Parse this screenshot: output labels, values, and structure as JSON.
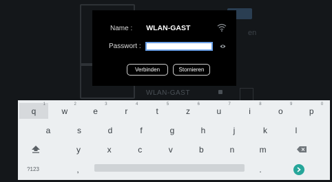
{
  "background": {
    "ssid_text": "WLAN-GAST",
    "partial_text": "en"
  },
  "dialog": {
    "name_label": "Name :",
    "name_value": "WLAN-GAST",
    "password_label": "Passwort :",
    "password_value": "",
    "connect_label": "Verbinden",
    "cancel_label": "Stornieren"
  },
  "keyboard": {
    "row1": [
      {
        "key": "q",
        "hint": "1"
      },
      {
        "key": "w",
        "hint": "2"
      },
      {
        "key": "e",
        "hint": "3"
      },
      {
        "key": "r",
        "hint": "4"
      },
      {
        "key": "t",
        "hint": "5"
      },
      {
        "key": "z",
        "hint": "6"
      },
      {
        "key": "u",
        "hint": "7"
      },
      {
        "key": "i",
        "hint": "8"
      },
      {
        "key": "o",
        "hint": "9"
      },
      {
        "key": "p",
        "hint": "0"
      }
    ],
    "row2": [
      "a",
      "s",
      "d",
      "f",
      "g",
      "h",
      "j",
      "k",
      "l"
    ],
    "row3": [
      "y",
      "x",
      "c",
      "v",
      "b",
      "n",
      "m"
    ],
    "symbols_label": "?123",
    "comma_label": ",",
    "period_label": ".",
    "icons": {
      "shift": "shift-arrow-icon",
      "backspace": "backspace-icon",
      "enter": "enter-arrow-icon"
    },
    "accent_color": "#26a69a"
  }
}
